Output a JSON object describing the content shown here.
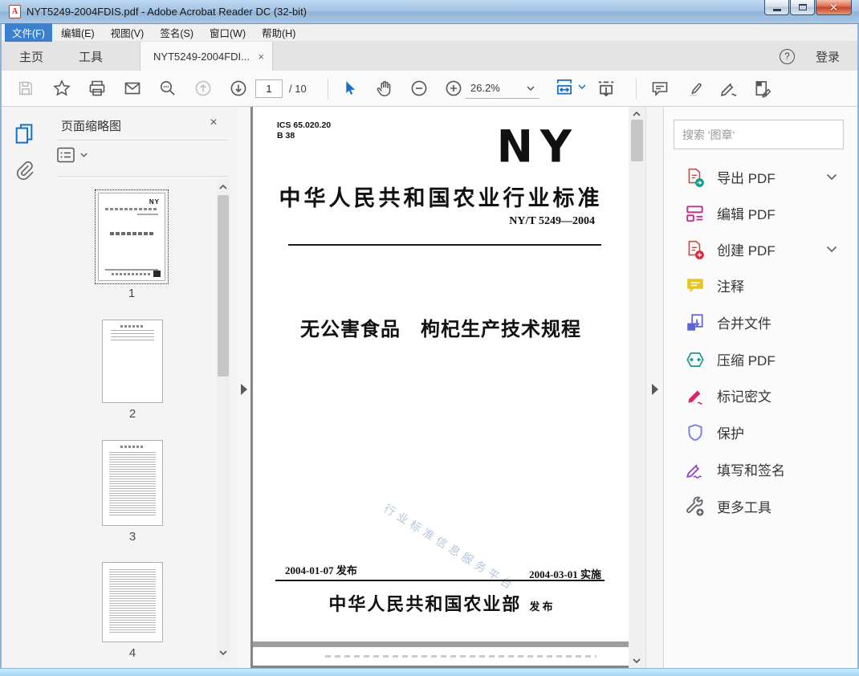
{
  "window": {
    "title": "NYT5249-2004FDIS.pdf - Adobe Acrobat Reader DC (32-bit)",
    "file_icon_letter": "A",
    "menu": [
      "文件(F)",
      "编辑(E)",
      "视图(V)",
      "签名(S)",
      "窗口(W)",
      "帮助(H)"
    ]
  },
  "tabbar": {
    "home": "主页",
    "tools": "工具",
    "doc_tab": "NYT5249-2004FDI...",
    "doc_tab_close": "×",
    "help": "?",
    "sign_in": "登录"
  },
  "toolbar": {
    "page_current": "1",
    "page_total": "/ 10",
    "zoom_level": "26.2%"
  },
  "left_panel": {
    "title": "页面缩略图",
    "close": "×",
    "thumbnails": [
      {
        "label": "1"
      },
      {
        "label": "2"
      },
      {
        "label": "3"
      },
      {
        "label": "4"
      }
    ]
  },
  "document": {
    "ics_line1": "ICS 65.020.20",
    "ics_line2": "B 38",
    "logo": "NY",
    "standard_heading": "中华人民共和国农业行业标准",
    "standard_number": "NY/T 5249—2004",
    "title": "无公害食品　枸杞生产技术规程",
    "watermark": "行业标准信息服务平台",
    "issue_date": "2004-01-07 发布",
    "implement_date": "2004-03-01 实施",
    "publisher": "中华人民共和国农业部",
    "publisher_suffix": "发 布"
  },
  "right_panel": {
    "search_placeholder": "搜索 '图章'",
    "tools": [
      {
        "label": "导出 PDF",
        "icon": "export-pdf-icon",
        "chevron": true
      },
      {
        "label": "编辑 PDF",
        "icon": "edit-pdf-icon",
        "chevron": false
      },
      {
        "label": "创建 PDF",
        "icon": "create-pdf-icon",
        "chevron": true
      },
      {
        "label": "注释",
        "icon": "comment-icon",
        "chevron": false
      },
      {
        "label": "合并文件",
        "icon": "combine-files-icon",
        "chevron": false
      },
      {
        "label": "压缩 PDF",
        "icon": "compress-pdf-icon",
        "chevron": false
      },
      {
        "label": "标记密文",
        "icon": "redact-icon",
        "chevron": false
      },
      {
        "label": "保护",
        "icon": "protect-icon",
        "chevron": false
      },
      {
        "label": "填写和签名",
        "icon": "fill-sign-icon",
        "chevron": false
      },
      {
        "label": "更多工具",
        "icon": "more-tools-icon",
        "chevron": false
      }
    ]
  }
}
